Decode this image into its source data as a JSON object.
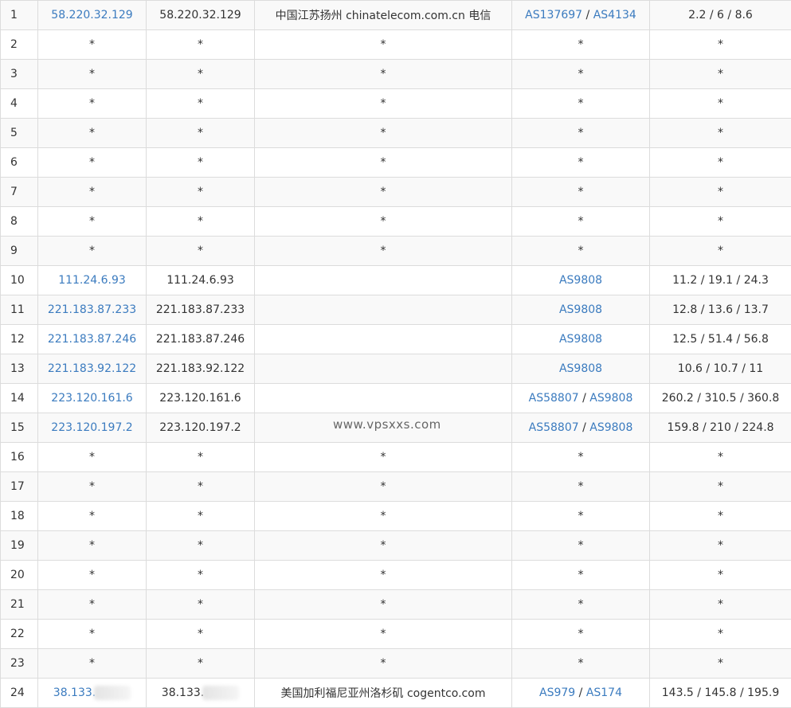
{
  "colors": {
    "link": "#3b7bbf",
    "text": "#333333",
    "border": "#dcdcdc",
    "stripe": "#f9f9f9"
  },
  "watermark": "www.vpsxxs.com",
  "rows": [
    {
      "hop": "1",
      "ip_link": "58.220.32.129",
      "ip": "58.220.32.129",
      "geo": "中国江苏扬州 chinatelecom.com.cn 电信",
      "asn": [
        "AS137697",
        "AS4134"
      ],
      "latency": "2.2 / 6 / 8.6"
    },
    {
      "hop": "2",
      "ip_link": "*",
      "ip": "*",
      "geo": "*",
      "asn": [
        "*"
      ],
      "latency": "*"
    },
    {
      "hop": "3",
      "ip_link": "*",
      "ip": "*",
      "geo": "*",
      "asn": [
        "*"
      ],
      "latency": "*"
    },
    {
      "hop": "4",
      "ip_link": "*",
      "ip": "*",
      "geo": "*",
      "asn": [
        "*"
      ],
      "latency": "*"
    },
    {
      "hop": "5",
      "ip_link": "*",
      "ip": "*",
      "geo": "*",
      "asn": [
        "*"
      ],
      "latency": "*"
    },
    {
      "hop": "6",
      "ip_link": "*",
      "ip": "*",
      "geo": "*",
      "asn": [
        "*"
      ],
      "latency": "*"
    },
    {
      "hop": "7",
      "ip_link": "*",
      "ip": "*",
      "geo": "*",
      "asn": [
        "*"
      ],
      "latency": "*"
    },
    {
      "hop": "8",
      "ip_link": "*",
      "ip": "*",
      "geo": "*",
      "asn": [
        "*"
      ],
      "latency": "*"
    },
    {
      "hop": "9",
      "ip_link": "*",
      "ip": "*",
      "geo": "*",
      "asn": [
        "*"
      ],
      "latency": "*"
    },
    {
      "hop": "10",
      "ip_link": "111.24.6.93",
      "ip": "111.24.6.93",
      "geo": "",
      "asn": [
        "AS9808"
      ],
      "latency": "11.2 / 19.1 / 24.3"
    },
    {
      "hop": "11",
      "ip_link": "221.183.87.233",
      "ip": "221.183.87.233",
      "geo": "",
      "asn": [
        "AS9808"
      ],
      "latency": "12.8 / 13.6 / 13.7"
    },
    {
      "hop": "12",
      "ip_link": "221.183.87.246",
      "ip": "221.183.87.246",
      "geo": "",
      "asn": [
        "AS9808"
      ],
      "latency": "12.5 / 51.4 / 56.8"
    },
    {
      "hop": "13",
      "ip_link": "221.183.92.122",
      "ip": "221.183.92.122",
      "geo": "",
      "asn": [
        "AS9808"
      ],
      "latency": "10.6 / 10.7 / 11"
    },
    {
      "hop": "14",
      "ip_link": "223.120.161.6",
      "ip": "223.120.161.6",
      "geo": "",
      "asn": [
        "AS58807",
        "AS9808"
      ],
      "latency": "260.2 / 310.5 / 360.8"
    },
    {
      "hop": "15",
      "ip_link": "223.120.197.2",
      "ip": "223.120.197.2",
      "geo": "",
      "asn": [
        "AS58807",
        "AS9808"
      ],
      "latency": "159.8 / 210 / 224.8"
    },
    {
      "hop": "16",
      "ip_link": "*",
      "ip": "*",
      "geo": "*",
      "asn": [
        "*"
      ],
      "latency": "*"
    },
    {
      "hop": "17",
      "ip_link": "*",
      "ip": "*",
      "geo": "*",
      "asn": [
        "*"
      ],
      "latency": "*"
    },
    {
      "hop": "18",
      "ip_link": "*",
      "ip": "*",
      "geo": "*",
      "asn": [
        "*"
      ],
      "latency": "*"
    },
    {
      "hop": "19",
      "ip_link": "*",
      "ip": "*",
      "geo": "*",
      "asn": [
        "*"
      ],
      "latency": "*"
    },
    {
      "hop": "20",
      "ip_link": "*",
      "ip": "*",
      "geo": "*",
      "asn": [
        "*"
      ],
      "latency": "*"
    },
    {
      "hop": "21",
      "ip_link": "*",
      "ip": "*",
      "geo": "*",
      "asn": [
        "*"
      ],
      "latency": "*"
    },
    {
      "hop": "22",
      "ip_link": "*",
      "ip": "*",
      "geo": "*",
      "asn": [
        "*"
      ],
      "latency": "*"
    },
    {
      "hop": "23",
      "ip_link": "*",
      "ip": "*",
      "geo": "*",
      "asn": [
        "*"
      ],
      "latency": "*"
    },
    {
      "hop": "24",
      "ip_link": "38.133.",
      "ip": "38.133.",
      "geo": "美国加利福尼亚州洛杉矶 cogentco.com",
      "asn": [
        "AS979",
        "AS174"
      ],
      "latency": "143.5 / 145.8 / 195.9",
      "ip_redacted": true
    }
  ]
}
